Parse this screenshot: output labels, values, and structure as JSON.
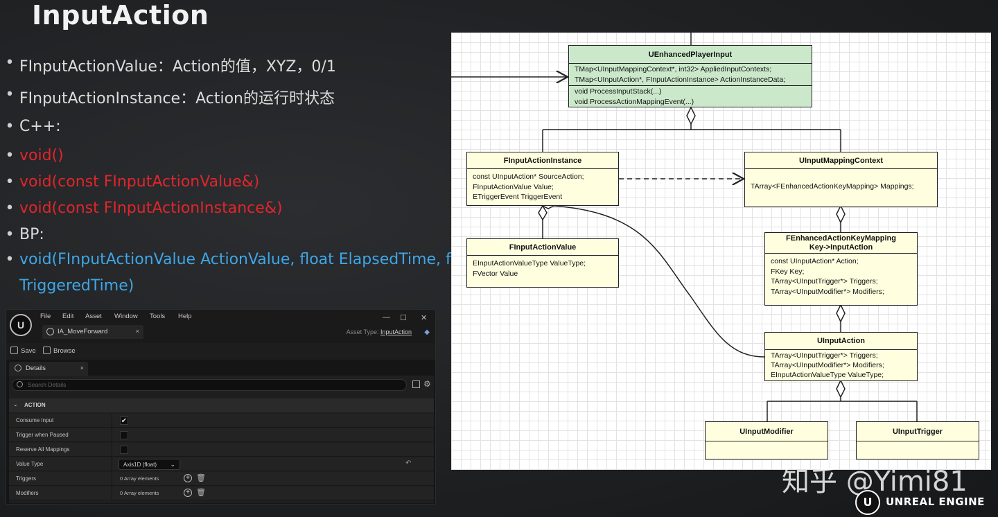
{
  "slide": {
    "title": "InputAction",
    "bullets": [
      {
        "text": "FInputActionValue：Action的值，XYZ，0/1",
        "color": "white"
      },
      {
        "text": "FInputActionInstance：Action的运行时状态",
        "color": "white"
      },
      {
        "text": "C++:",
        "color": "white"
      },
      {
        "text": "void()",
        "color": "red"
      },
      {
        "text": "void(const FInputActionValue&)",
        "color": "red"
      },
      {
        "text": "void(const FInputActionInstance&)",
        "color": "red"
      },
      {
        "text": "BP:",
        "color": "white"
      },
      {
        "text": "void(FInputActionValue ActionValue, float ElapsedTime, float",
        "color": "blue"
      },
      {
        "text": "TriggeredTime)",
        "color": "blue"
      }
    ],
    "bullet_glyph": "•",
    "colors": {
      "white": "#dcdcdc",
      "red": "#e0262b",
      "blue": "#3fa6e6"
    }
  },
  "editor": {
    "logo": "U",
    "menu": [
      "File",
      "Edit",
      "Asset",
      "Window",
      "Tools",
      "Help"
    ],
    "window_controls": [
      "—",
      "☐",
      "✕"
    ],
    "tab": {
      "label": "IA_MoveForward",
      "close": "×"
    },
    "asset_type_label": "Asset Type:",
    "asset_type_value": "InputAction",
    "toolbar": {
      "save": "Save",
      "browse": "Browse"
    },
    "details_tab": {
      "label": "Details",
      "close": "×"
    },
    "search_placeholder": "Search Details",
    "section": {
      "label": "ACTION",
      "chevron": "⌄"
    },
    "rows": [
      {
        "label": "Consume Input",
        "kind": "checkbox",
        "checked": true
      },
      {
        "label": "Trigger when Paused",
        "kind": "checkbox",
        "checked": false
      },
      {
        "label": "Reserve All Mappings",
        "kind": "checkbox",
        "checked": false
      },
      {
        "label": "Value Type",
        "kind": "dropdown",
        "value": "Axis1D (float)",
        "chevron": "⌄",
        "reset": "↶"
      },
      {
        "label": "Triggers",
        "kind": "array",
        "value": "0 Array elements"
      },
      {
        "label": "Modifiers",
        "kind": "array",
        "value": "0 Array elements"
      }
    ],
    "icons": {
      "plus": "+",
      "trash": "🗑",
      "gear": "⚙",
      "check": "✔"
    }
  },
  "diagram": {
    "classes": [
      {
        "id": "player",
        "title": "UEnhancedPlayerInput",
        "fill": "#cbe8cb",
        "sections": [
          [
            "TMap<UInputMappingContext*, int32> AppliedInputContexts;",
            "TMap<UInputAction*, FInputActionInstance> ActionInstanceData;"
          ],
          [
            "void ProcessInputStack(...)",
            "void ProcessActionMappingEvent(...)"
          ]
        ]
      },
      {
        "id": "instance",
        "title": "FInputActionInstance",
        "fill": "#ffffe0",
        "sections": [
          [
            "const UInputAction* SourceAction;",
            "FInputActionValue Value;",
            "ETriggerEvent TriggerEvent"
          ]
        ]
      },
      {
        "id": "context",
        "title": "UInputMappingContext",
        "fill": "#ffffe0",
        "sections": [
          [
            "TArray<FEnhancedActionKeyMapping> Mappings;"
          ]
        ]
      },
      {
        "id": "value",
        "title": "FInputActionValue",
        "fill": "#ffffe0",
        "sections": [
          [
            "EInputActionValueType ValueType;",
            "FVector Value"
          ]
        ]
      },
      {
        "id": "mapping",
        "title": "FEnhancedActionKeyMapping\nKey->InputAction",
        "fill": "#ffffe0",
        "sections": [
          [
            "const UInputAction* Action;",
            "FKey Key;",
            "TArray<UInputTrigger*> Triggers;",
            "TArray<UInputModifier*> Modifiers;"
          ]
        ]
      },
      {
        "id": "action",
        "title": "UInputAction",
        "fill": "#ffffe0",
        "sections": [
          [
            "TArray<UInputTrigger*> Triggers;",
            "TArray<UInputModifier*> Modifiers;",
            "EInputActionValueType ValueType;"
          ]
        ]
      },
      {
        "id": "modifier",
        "title": "UInputModifier",
        "fill": "#ffffe0",
        "sections": [
          []
        ]
      },
      {
        "id": "trigger",
        "title": "UInputTrigger",
        "fill": "#ffffe0",
        "sections": [
          []
        ]
      }
    ]
  },
  "watermark": "知乎 @Yimi81",
  "brand": {
    "logo": "U",
    "text": "UNREAL ENGINE"
  }
}
